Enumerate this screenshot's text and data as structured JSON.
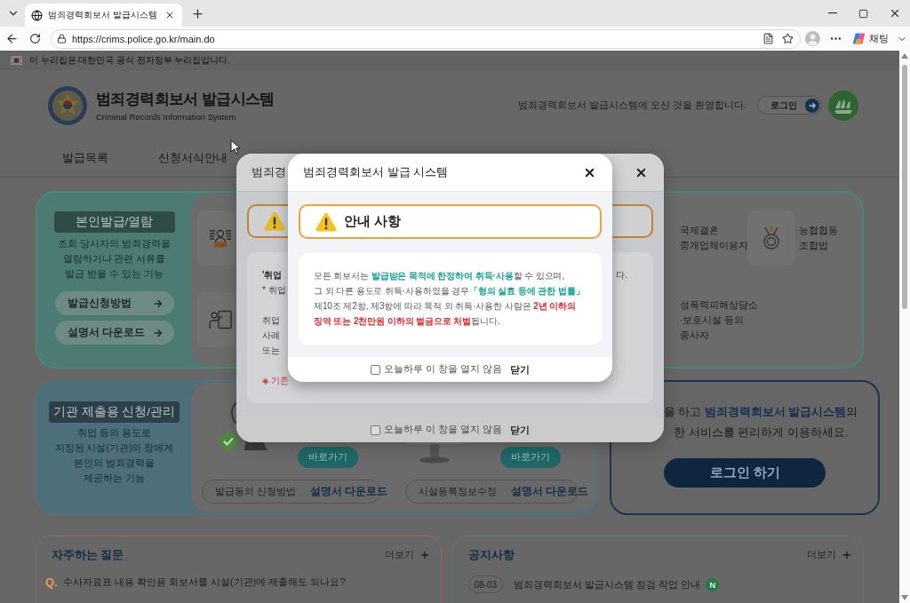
{
  "browser": {
    "tab": {
      "title": "범죄경력회보서 발급시스템",
      "selected": true
    },
    "url": "https://crims.police.go.kr/main.do",
    "chat_label": "채팅"
  },
  "gov_banner": {
    "text": "이 누리집은 대한민국 공식 전자정부 누리집입니다."
  },
  "header": {
    "title": "범죄경력회보서 발급시스템",
    "subtitle": "Criminal Records Information System",
    "welcome": "범죄경력회보서 발급시스템에 오신 것을 환영합니다.",
    "login": "로그인"
  },
  "nav": [
    {
      "label": "발급목록"
    },
    {
      "label": "신청서식안내"
    }
  ],
  "personal_service": {
    "title": "본인발급/열람",
    "description": "조회 당사자의 범죄경력을\n열람하거나 관련 서류를\n발급 받을 수 있는 기능",
    "buttons": [
      "발급신청방법",
      "설명서 다운로드"
    ],
    "tiles": [
      {
        "kind": "icon"
      },
      {
        "kind": "label",
        "label": "국제결혼\n중개업체이용자"
      },
      {
        "kind": "icon_label",
        "label": "농협협동\n조합법"
      },
      {
        "kind": "icon"
      },
      {
        "kind": "label",
        "label": "성폭력피해상담소\n·보호시설 등의\n종사자"
      }
    ]
  },
  "institution_service": {
    "title": "기관 제출용 신청/관리",
    "description": "취업 등의 용도로\n지정된 시설(기관)의 장에게\n본인의 범죄경력을\n제공하는 기능",
    "services": [
      {
        "button": "바로가기",
        "guide": "발급동의 신청방법",
        "download": "설명서 다운로드"
      },
      {
        "button": "바로가기",
        "guide": "시설등록정보수정",
        "download": "설명서 다운로드"
      }
    ]
  },
  "login_card": {
    "lines": [
      "을 하고 **범죄경력회보서 발급시스템**의",
      "한 서비스를 편리하게 이용하세요."
    ],
    "button": "로그인 하기"
  },
  "faq": {
    "title": "자주하는 질문",
    "more": "더보기",
    "items": [
      {
        "marker": "Q.",
        "question": "수사자료표 내용 확인용 회보서를 시설(기관)에 제출해도 되나요?"
      }
    ]
  },
  "notices": {
    "title": "공지사항",
    "more": "더보기",
    "items": [
      {
        "date": "08-03",
        "title": "범죄경력회보서 발급시스템 점검 작업 안내",
        "badge": "N"
      }
    ]
  },
  "back_dialog": {
    "title": "범죄경",
    "paragraphs": [
      [
        {
          "kind": "heading",
          "text": "'취업",
          "tail": "다."
        },
        {
          "kind": "plain",
          "text": "* 취업"
        }
      ],
      [
        {
          "kind": "plain",
          "text": "취업"
        },
        {
          "kind": "plain",
          "text": "사례"
        },
        {
          "kind": "plain",
          "text": "또는"
        }
      ],
      [
        {
          "kind": "alert",
          "text": "◈ 기존"
        }
      ]
    ],
    "dont_show": {
      "label": "오늘하루 이 창을 열지 않음",
      "checked": false
    },
    "close": "닫기"
  },
  "front_dialog": {
    "title": "범죄경력회보서 발급 시스템",
    "notice_title": "안내 사항",
    "message": [
      {
        "kind": "plain",
        "text": "모든 회보서는 "
      },
      {
        "kind": "highlight",
        "text": "발급받은 목적에 한정하여 취득·사용"
      },
      {
        "kind": "plain",
        "text": "할 수 있으며,\n그 외 다른 용도로 취득·사용하였을 경우"
      },
      {
        "kind": "highlight",
        "text": "「형의 실효 등에 관한 법률」"
      },
      {
        "kind": "plain",
        "text": "\n제10조 제2항, 제3항에 따라 목적 외 취득·사용한 사람은 "
      },
      {
        "kind": "warning",
        "text": "2년 이하의\n징역 또는 2천만원 이하의 벌금으로 처벌"
      },
      {
        "kind": "plain",
        "text": "됩니다."
      }
    ],
    "dont_show": {
      "label": "오늘하루 이 창을 열지 않음",
      "checked": false
    },
    "close": "닫기"
  }
}
